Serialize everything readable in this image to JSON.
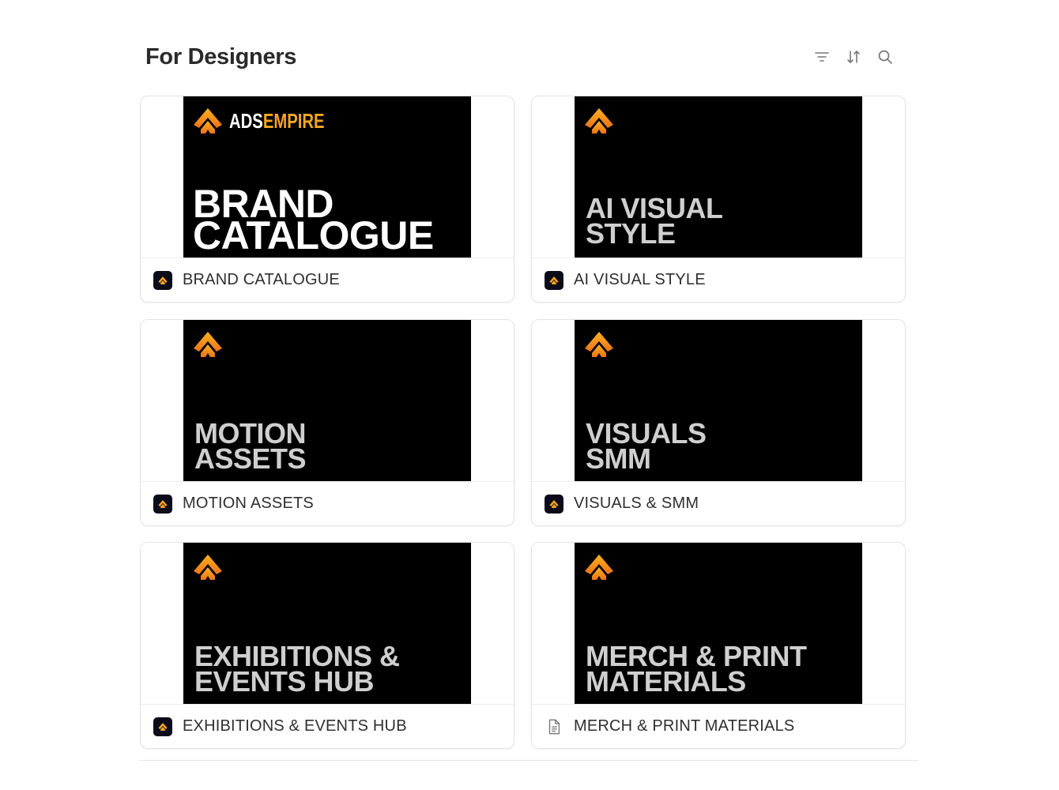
{
  "page": {
    "title": "For Designers"
  },
  "toolbar": {
    "filter_icon": "filter-icon",
    "sort_icon": "sort-icon",
    "search_icon": "search-icon"
  },
  "brand": {
    "wordmark_a": "ADS",
    "wordmark_b": "EMPIRE",
    "accent_color": "#f5a623"
  },
  "cards": [
    {
      "cover_line1": "BRAND",
      "cover_line2": "CATALOGUE",
      "label": "BRAND CATALOGUE",
      "icon": "brand-logo-icon"
    },
    {
      "cover_line1": "AI VISUAL",
      "cover_line2": "STYLE",
      "label": "AI VISUAL STYLE",
      "icon": "brand-logo-icon"
    },
    {
      "cover_line1": "MOTION",
      "cover_line2": "ASSETS",
      "label": "MOTION ASSETS",
      "icon": "brand-logo-icon"
    },
    {
      "cover_line1": "VISUALS",
      "cover_line2": "SMM",
      "label": "VISUALS & SMM",
      "icon": "brand-logo-icon"
    },
    {
      "cover_line1": "EXHIBITIONS &",
      "cover_line2": "EVENTS HUB",
      "label": "EXHIBITIONS & EVENTS HUB",
      "icon": "brand-logo-icon"
    },
    {
      "cover_line1": "MERCH & PRINT",
      "cover_line2": "MATERIALS",
      "label": "MERCH & PRINT MATERIALS",
      "icon": "document-icon"
    }
  ]
}
